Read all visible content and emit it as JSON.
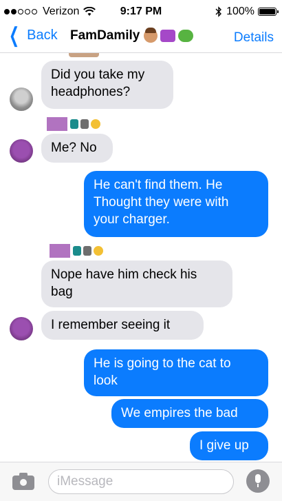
{
  "status_bar": {
    "carrier": "Verizon",
    "time": "9:17 PM",
    "battery": "100%",
    "signal_filled": 2,
    "signal_total": 5
  },
  "nav": {
    "back_label": "Back",
    "title": "FamDamily",
    "details_label": "Details",
    "accent_color": "#0b7cfe"
  },
  "messages": [
    {
      "direction": "incoming",
      "text": "Did you take my\nheadphones?"
    },
    {
      "direction": "incoming",
      "text": "Me? No"
    },
    {
      "direction": "outgoing",
      "text": "He can't find them. He\nThought they were with\nyour charger."
    },
    {
      "direction": "incoming",
      "text": "Nope have him check his\nbag"
    },
    {
      "direction": "incoming",
      "text": "I remember seeing it"
    },
    {
      "direction": "outgoing",
      "text": "He is going to the cat to\nlook"
    },
    {
      "direction": "outgoing",
      "text": "We empires the bad"
    },
    {
      "direction": "outgoing",
      "text": "I give up"
    }
  ],
  "composer": {
    "placeholder": "iMessage",
    "value": ""
  },
  "icons": {
    "wifi": "wifi-icon",
    "bluetooth": "bluetooth-icon",
    "camera": "camera-icon",
    "microphone": "microphone-icon",
    "back": "chevron-left-icon"
  },
  "colors": {
    "incoming_bubble": "#e5e5ea",
    "outgoing_bubble": "#0b7cfe"
  }
}
